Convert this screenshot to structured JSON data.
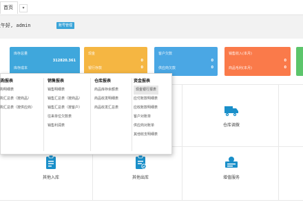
{
  "tabs": {
    "home": "首页",
    "dropdown": "▾"
  },
  "greeting": {
    "text": "上午好, admin",
    "badge": "账号管理"
  },
  "cards": [
    {
      "label1": "库存总量",
      "value1": "312820.361",
      "label2": "库存成本",
      "value2": ""
    },
    {
      "label1": "现金",
      "value1": "0",
      "label2": "银行存款",
      "value2": "0"
    },
    {
      "label1": "客户欠款",
      "value1": "0",
      "label2": "供应商欠款",
      "value2": "0"
    },
    {
      "label1": "销售收入(本月)",
      "value1": "0",
      "label2": "商品毛利(本月)",
      "value2": "0"
    },
    {
      "label1": "",
      "value1": "",
      "label2": "",
      "value2": ""
    }
  ],
  "menu": {
    "col1": {
      "title": "采购报表",
      "items": [
        "采购明细表",
        "采购汇总表（按商品）",
        "采购汇总表（按供应商）"
      ]
    },
    "col2": {
      "title": "销售报表",
      "items": [
        "销售明细表",
        "销售汇总表（按商品）",
        "销售汇总表（按客户）",
        "往来单位欠款表",
        "销售利润表"
      ]
    },
    "col3": {
      "title": "仓库报表",
      "items": [
        "商品库存余额表",
        "商品收发明细表",
        "商品收发汇总表"
      ]
    },
    "col4": {
      "title": "资金报表",
      "items": [
        "现金银行报表",
        "应付账款明细表",
        "应收账款明细表",
        "客户对账单",
        "供应商对账单",
        "其他收支明细表"
      ]
    }
  },
  "tiles": [
    {
      "label": "仓库调拨",
      "icon": "warehouse-transfer-icon"
    },
    {
      "label": "其他入库",
      "icon": "clipboard-in-icon"
    },
    {
      "label": "其他出库",
      "icon": "clipboard-out-icon"
    },
    {
      "label": "增值服务",
      "icon": "service-icon"
    }
  ],
  "colors": {
    "accent": "#2a9fd6",
    "tile_icon": "#1a8fc9"
  }
}
